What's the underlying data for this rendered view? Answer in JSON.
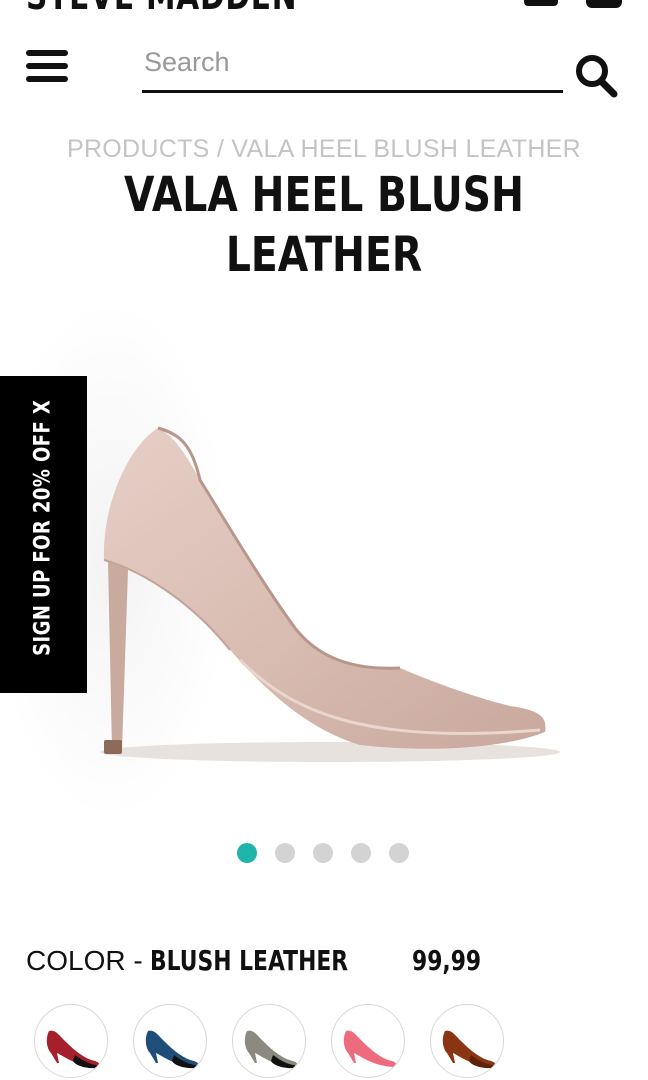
{
  "header": {
    "brand": "STEVE MADDEN",
    "search_placeholder": "Search"
  },
  "breadcrumb": "PRODUCTS / VALA HEEL BLUSH LEATHER",
  "title": "VALA HEEL BLUSH LEATHER",
  "promo_tab": "SIGN UP FOR 20% OFF X",
  "carousel": {
    "total": 5,
    "active": 1
  },
  "product": {
    "color_label": "COLOR -",
    "color_value": "BLUSH LEATHER",
    "price": "99,99",
    "shoe_color": "#dcc1b8"
  },
  "swatches": [
    {
      "name": "red patent",
      "color": "#a4202b"
    },
    {
      "name": "blue patent",
      "color": "#1e4e79"
    },
    {
      "name": "grey metallic",
      "color": "#8c8a80"
    },
    {
      "name": "pink",
      "color": "#ee6b7e"
    },
    {
      "name": "brown patent",
      "color": "#8a3414"
    }
  ],
  "colors": {
    "accent": "#1fb5a8",
    "text": "#111111",
    "muted": "#c4c4c4"
  }
}
